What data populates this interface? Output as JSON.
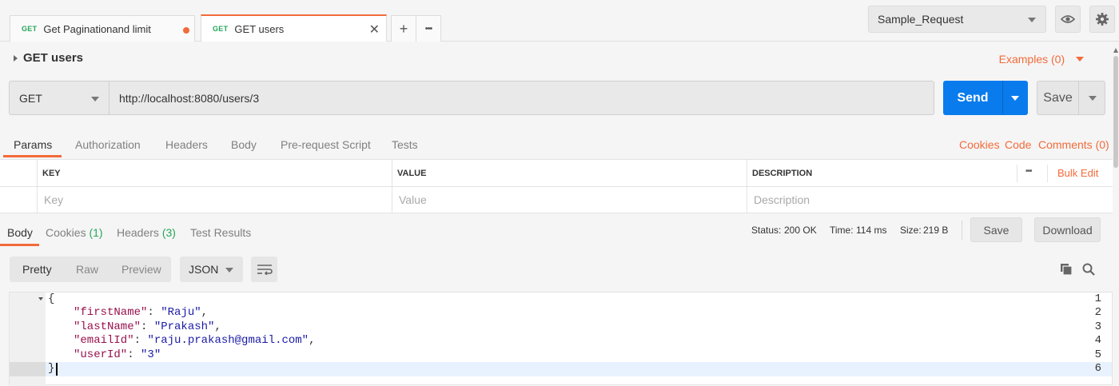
{
  "tabs": [
    {
      "method": "GET",
      "title": "Get Paginationand limit",
      "unsaved": true
    },
    {
      "method": "GET",
      "title": "GET users",
      "active": true
    }
  ],
  "tab_buttons": {
    "add": "+",
    "more": "•••"
  },
  "environment": {
    "selected": "Sample_Request"
  },
  "request": {
    "name": "GET users",
    "examples": "Examples (0)",
    "method": "GET",
    "url": "http://localhost:8080/users/3",
    "send": "Send",
    "save": "Save"
  },
  "request_tabs": [
    "Params",
    "Authorization",
    "Headers",
    "Body",
    "Pre-request Script",
    "Tests"
  ],
  "request_links": {
    "cookies": "Cookies",
    "code": "Code",
    "comments": "Comments (0)"
  },
  "params_table": {
    "headers": {
      "key": "KEY",
      "value": "VALUE",
      "description": "DESCRIPTION"
    },
    "more": "•••",
    "bulk_edit": "Bulk Edit",
    "placeholders": {
      "key": "Key",
      "value": "Value",
      "description": "Description"
    }
  },
  "response": {
    "tabs": {
      "body": "Body",
      "cookies": "Cookies",
      "cookies_count": "(1)",
      "headers": "Headers",
      "headers_count": "(3)",
      "test_results": "Test Results"
    },
    "status_label": "Status:",
    "status_value": "200 OK",
    "time_label": "Time:",
    "time_value": "114 ms",
    "size_label": "Size:",
    "size_value": "219 B",
    "save": "Save",
    "download": "Download"
  },
  "view": {
    "modes": [
      "Pretty",
      "Raw",
      "Preview"
    ],
    "active_mode": "Pretty",
    "format": "JSON"
  },
  "code": {
    "line_numbers": [
      "1",
      "2",
      "3",
      "4",
      "5",
      "6"
    ],
    "open_brace": "{",
    "close_brace": "}",
    "fields": [
      {
        "key": "\"firstName\"",
        "value": "\"Raju\"",
        "comma": ","
      },
      {
        "key": "\"lastName\"",
        "value": "\"Prakash\"",
        "comma": ","
      },
      {
        "key": "\"emailId\"",
        "value": "\"raju.prakash@gmail.com\"",
        "comma": ","
      },
      {
        "key": "\"userId\"",
        "value": "\"3\"",
        "comma": ""
      }
    ]
  },
  "colors": {
    "accent": "#f26b3a",
    "send": "#097bed",
    "success": "#26a65b"
  }
}
